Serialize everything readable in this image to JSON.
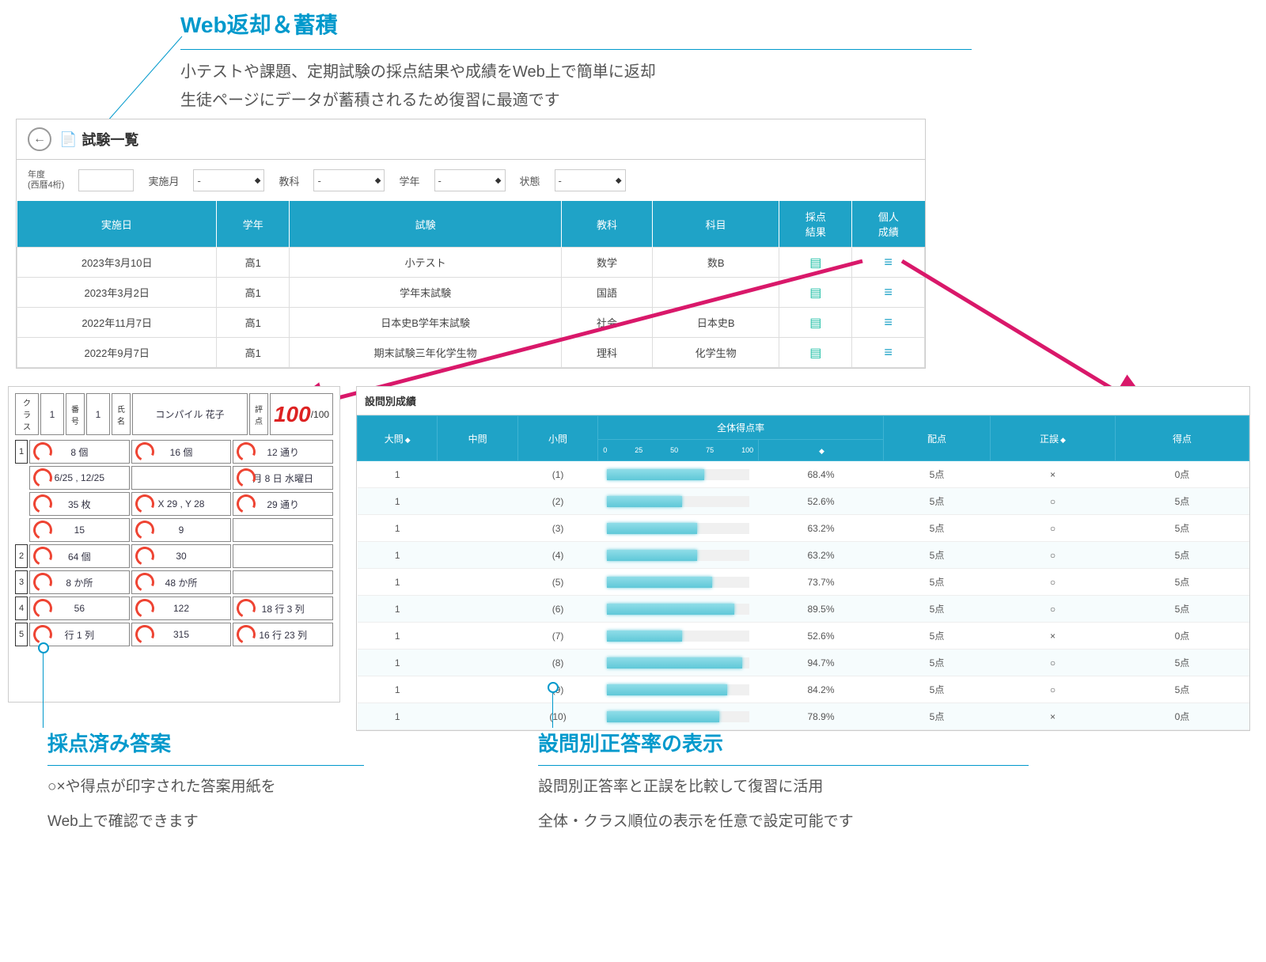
{
  "top": {
    "title": "Web返却＆蓄積",
    "body1": "小テストや課題、定期試験の採点結果や成績をWeb上で簡単に返却",
    "body2": "生徒ページにデータが蓄積されるため復習に最適です"
  },
  "examList": {
    "title": "試験一覧",
    "filters": {
      "yearLabel": "年度\n(西暦4桁)",
      "monthLabel": "実施月",
      "subjectLabel": "教科",
      "gradeLabel": "学年",
      "statusLabel": "状態",
      "placeholder": "-"
    },
    "columns": [
      "実施日",
      "学年",
      "試験",
      "教科",
      "科目",
      "採点\n結果",
      "個人\n成績"
    ],
    "rows": [
      {
        "date": "2023年3月10日",
        "grade": "高1",
        "exam": "小テスト",
        "subj": "数学",
        "course": "数B"
      },
      {
        "date": "2023年3月2日",
        "grade": "高1",
        "exam": "学年末試験",
        "subj": "国語",
        "course": ""
      },
      {
        "date": "2022年11月7日",
        "grade": "高1",
        "exam": "日本史B学年末試験",
        "subj": "社会",
        "course": "日本史B"
      },
      {
        "date": "2022年9月7日",
        "grade": "高1",
        "exam": "期末試験三年化学生物",
        "subj": "理科",
        "course": "化学生物"
      }
    ]
  },
  "answerSheet": {
    "score": "100",
    "scoreMax": "/100",
    "headerLabels": {
      "class": "クラス",
      "num": "番号",
      "name": "氏名",
      "pts": "評点"
    },
    "rows": [
      [
        "8 個",
        "16 個",
        "12 通り"
      ],
      [
        "6/25 , 12/25",
        "",
        "月 8 日 水曜日"
      ],
      [
        "35 枚",
        "X 29 , Y 28",
        "29 通り"
      ],
      [
        "15",
        "9",
        ""
      ],
      [
        "64 個",
        "30",
        ""
      ],
      [
        "8 か所",
        "48 か所",
        ""
      ],
      [
        "56",
        "122",
        "18 行 3 列"
      ],
      [
        "行 1 列",
        "315",
        "16 行 23 列"
      ]
    ],
    "nums": [
      "1",
      "2",
      "3",
      "4",
      "5"
    ]
  },
  "qres": {
    "title": "設問別成績",
    "columns": {
      "q": "大問",
      "mid": "中問",
      "sub": "小問",
      "rate": "全体得点率",
      "alloc": "配点",
      "correct": "正誤",
      "score": "得点"
    },
    "ticks": [
      "0",
      "25",
      "50",
      "75",
      "100"
    ],
    "rows": [
      {
        "q": "1",
        "sub": "(1)",
        "rate": 68.4,
        "alloc": "5点",
        "correct": "×",
        "score": "0点"
      },
      {
        "q": "1",
        "sub": "(2)",
        "rate": 52.6,
        "alloc": "5点",
        "correct": "○",
        "score": "5点"
      },
      {
        "q": "1",
        "sub": "(3)",
        "rate": 63.2,
        "alloc": "5点",
        "correct": "○",
        "score": "5点"
      },
      {
        "q": "1",
        "sub": "(4)",
        "rate": 63.2,
        "alloc": "5点",
        "correct": "○",
        "score": "5点"
      },
      {
        "q": "1",
        "sub": "(5)",
        "rate": 73.7,
        "alloc": "5点",
        "correct": "○",
        "score": "5点"
      },
      {
        "q": "1",
        "sub": "(6)",
        "rate": 89.5,
        "alloc": "5点",
        "correct": "○",
        "score": "5点"
      },
      {
        "q": "1",
        "sub": "(7)",
        "rate": 52.6,
        "alloc": "5点",
        "correct": "×",
        "score": "0点"
      },
      {
        "q": "1",
        "sub": "(8)",
        "rate": 94.7,
        "alloc": "5点",
        "correct": "○",
        "score": "5点"
      },
      {
        "q": "1",
        "sub": "(9)",
        "rate": 84.2,
        "alloc": "5点",
        "correct": "○",
        "score": "5点"
      },
      {
        "q": "1",
        "sub": "(10)",
        "rate": 78.9,
        "alloc": "5点",
        "correct": "×",
        "score": "0点"
      }
    ]
  },
  "bl": {
    "title": "採点済み答案",
    "body1": "○×や得点が印字された答案用紙を",
    "body2": "Web上で確認できます"
  },
  "br": {
    "title": "設問別正答率の表示",
    "body1": "設問別正答率と正誤を比較して復習に活用",
    "body2": "全体・クラス順位の表示を任意で設定可能です"
  }
}
